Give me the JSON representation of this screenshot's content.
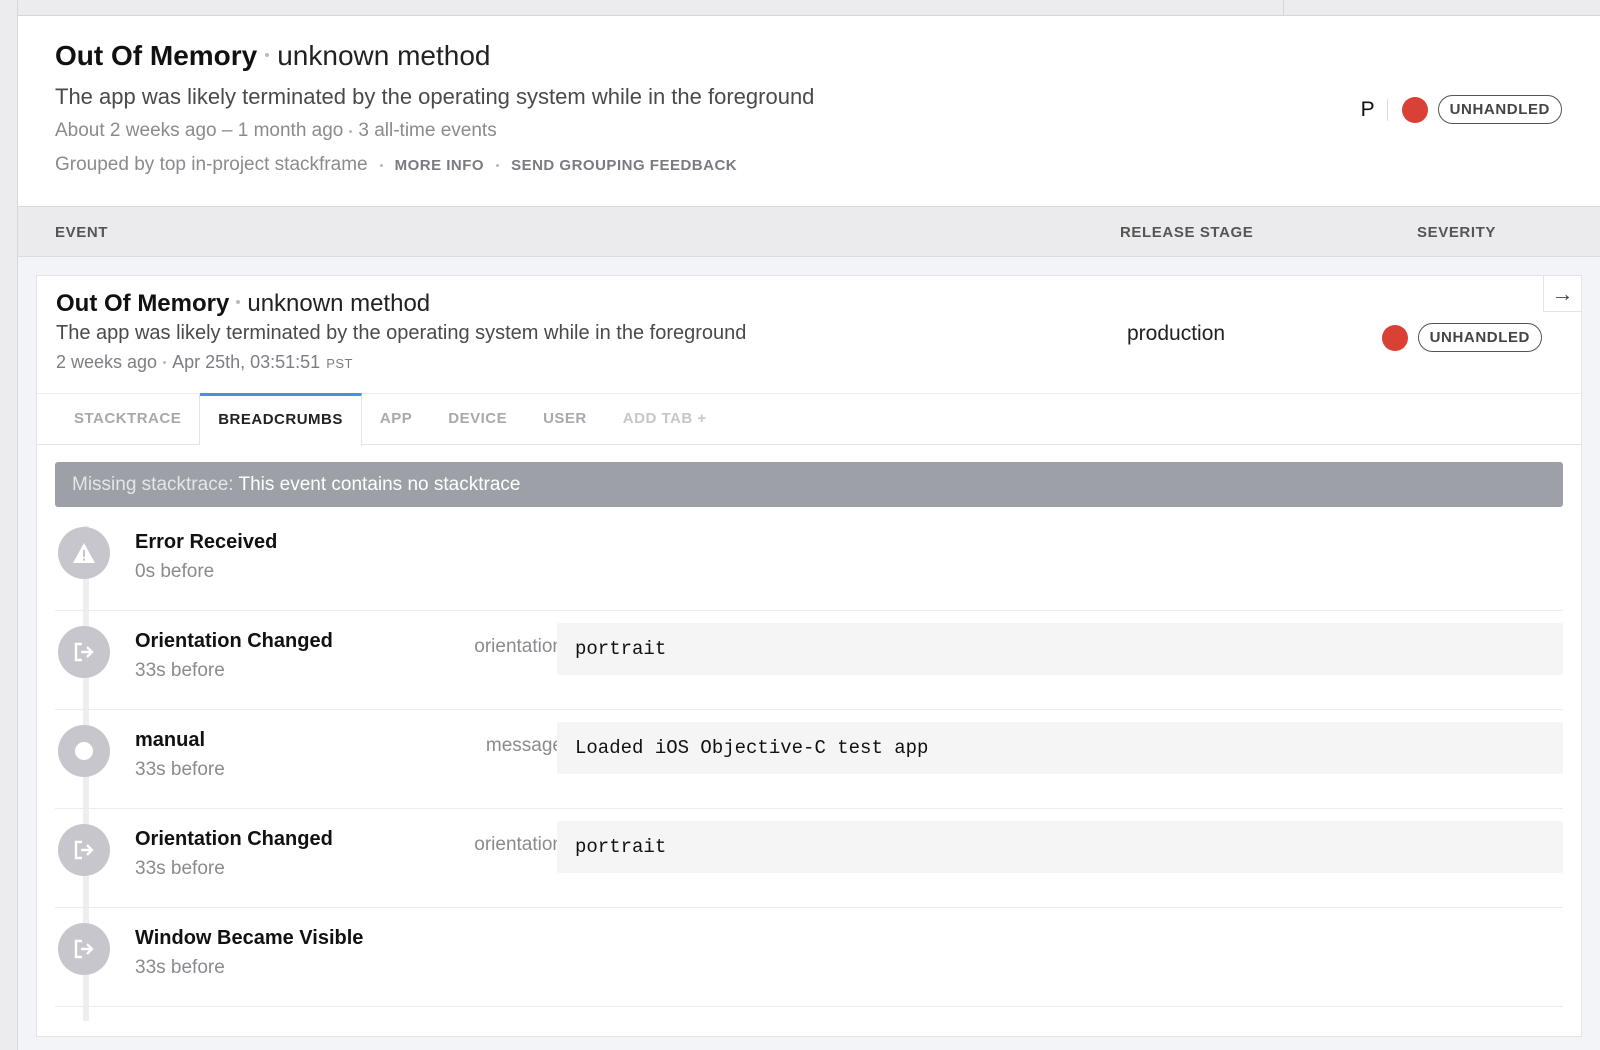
{
  "error": {
    "class": "Out Of Memory",
    "context": "unknown method",
    "message": "The app was likely terminated by the operating system while in the foreground",
    "timeframe": "About 2 weeks ago – 1 month ago",
    "events_count": "3 all-time events",
    "grouping": "Grouped by top in-project stackframe",
    "more_info": "MORE INFO",
    "send_feedback": "SEND GROUPING FEEDBACK",
    "priority_letter": "P",
    "handled_badge": "UNHANDLED"
  },
  "columns": {
    "event": "EVENT",
    "release_stage": "RELEASE STAGE",
    "severity": "SEVERITY"
  },
  "event": {
    "class": "Out Of Memory",
    "context": "unknown method",
    "message": "The app was likely terminated by the operating system while in the foreground",
    "relative_time": "2 weeks ago",
    "timestamp": "Apr 25th, 03:51:51",
    "timezone": "PST",
    "release_stage": "production",
    "handled_badge": "UNHANDLED"
  },
  "tabs": [
    {
      "label": "STACKTRACE"
    },
    {
      "label": "BREADCRUMBS"
    },
    {
      "label": "APP"
    },
    {
      "label": "DEVICE"
    },
    {
      "label": "USER"
    },
    {
      "label": "ADD TAB +"
    }
  ],
  "active_tab": "BREADCRUMBS",
  "missing_stacktrace": {
    "label": "Missing stacktrace:",
    "text": "This event contains no stacktrace"
  },
  "breadcrumbs": [
    {
      "name": "Error Received",
      "time": "0s before",
      "key": "",
      "value": "",
      "icon": "warning-icon"
    },
    {
      "name": "Orientation Changed",
      "time": "33s before",
      "key": "orientation",
      "value": "portrait",
      "icon": "navigation-icon"
    },
    {
      "name": "manual",
      "time": "33s before",
      "key": "message",
      "value": "Loaded iOS Objective-C test app",
      "icon": "manual-dot-icon"
    },
    {
      "name": "Orientation Changed",
      "time": "33s before",
      "key": "orientation",
      "value": "portrait",
      "icon": "navigation-icon"
    },
    {
      "name": "Window Became Visible",
      "time": "33s before",
      "key": "",
      "value": "",
      "icon": "navigation-icon"
    }
  ],
  "colors": {
    "severity_error": "#d94135",
    "active_tab_accent": "#4a90d9",
    "banner_bg": "#9ea0a8"
  }
}
